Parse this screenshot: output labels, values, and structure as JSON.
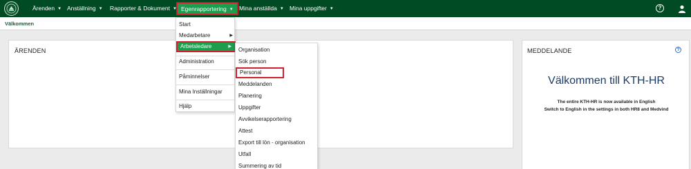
{
  "nav": {
    "items": [
      {
        "label": "Ärenden"
      },
      {
        "label": "Anställning"
      },
      {
        "label": "Rapporter & Dokument"
      },
      {
        "label": "Egenrapportering"
      },
      {
        "label": "Mina anställda"
      },
      {
        "label": "Mina uppgifter"
      }
    ],
    "caret": "▼",
    "help_symbol": "?"
  },
  "breadcrumb": "Välkommen",
  "panels": {
    "cases_title": "ÄRENDEN",
    "messages_title": "MEDDELANDE",
    "help_symbol": "?",
    "welcome_heading": "Välkommen till KTH-HR",
    "welcome_line1": "The entire KTH-HR is now available in English",
    "welcome_line2": "Switch to English in the settings in both HR8 and Medvind"
  },
  "menu_egenrapportering": {
    "items": [
      {
        "label": "Start"
      },
      {
        "label": "Medarbetare"
      },
      {
        "label": "Arbetsledare"
      },
      {
        "label": "Administration"
      },
      {
        "label": "Påminnelser"
      },
      {
        "label": "Mina Inställningar"
      },
      {
        "label": "Hjälp"
      }
    ],
    "arrow": "▶"
  },
  "menu_arbetsledare": {
    "items": [
      {
        "label": "Organisation"
      },
      {
        "label": "Sök person"
      },
      {
        "label": "Personal"
      },
      {
        "label": "Meddelanden"
      },
      {
        "label": "Planering"
      },
      {
        "label": "Uppgifter"
      },
      {
        "label": "Avvikelserapportering"
      },
      {
        "label": "Attest"
      },
      {
        "label": "Export till lön - organisation"
      },
      {
        "label": "Utfall"
      },
      {
        "label": "Summering av tid"
      }
    ]
  },
  "colors": {
    "topbar": "#004b23",
    "active": "#1c9e4e",
    "highlight_border": "#d21d2a",
    "heading": "#1b3a63"
  },
  "icons": {
    "logo": "kth-logo",
    "help": "help-circle-icon",
    "user": "user-icon"
  }
}
